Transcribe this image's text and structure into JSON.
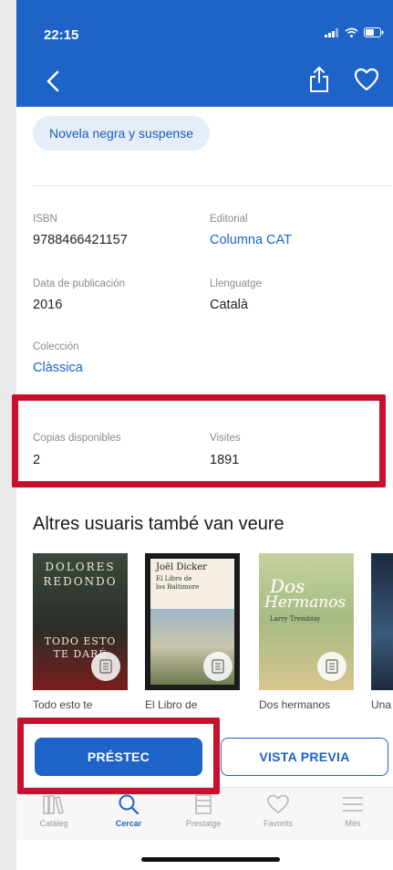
{
  "status_bar": {
    "time": "22:15"
  },
  "header": {
    "back_icon": "chevron-left-icon",
    "share_icon": "share-icon",
    "favorite_icon": "heart-icon",
    "color": "#1d63c8"
  },
  "genre_chip": "Novela negra y suspense",
  "details": {
    "isbn": {
      "label": "ISBN",
      "value": "9788466421157"
    },
    "publisher": {
      "label": "Editorial",
      "value": "Columna CAT"
    },
    "publication_date": {
      "label": "Data de publicación",
      "value": "2016"
    },
    "language": {
      "label": "Llenguatge",
      "value": "Català"
    },
    "collection": {
      "label": "Colección",
      "value": "Clàssica"
    },
    "copies": {
      "label": "Copias disponibles",
      "value": "2"
    },
    "visits": {
      "label": "Visites",
      "value": "1891"
    }
  },
  "related": {
    "title": "Altres usuaris també van veure",
    "books": [
      {
        "caption": "Todo esto te",
        "cover_lines": [
          "DOLORES",
          "REDONDO",
          "TODO ESTO",
          "TE DARÉ"
        ]
      },
      {
        "caption": "El Libro de",
        "cover_lines": [
          "Joël Dicker",
          "El Libro de",
          "los Baltimore"
        ]
      },
      {
        "caption": "Dos hermanos",
        "cover_lines": [
          "Dos",
          "Hermanos",
          "Larry Tremblay"
        ]
      },
      {
        "caption": "Una",
        "cover_lines": []
      }
    ]
  },
  "actions": {
    "loan_label": "PRÉSTEC",
    "preview_label": "VISTA PREVIA"
  },
  "tabs": [
    {
      "label": "Catàleg",
      "icon": "books-icon",
      "active": false
    },
    {
      "label": "Cercar",
      "icon": "search-icon",
      "active": true
    },
    {
      "label": "Prestatge",
      "icon": "shelf-icon",
      "active": false
    },
    {
      "label": "Favorits",
      "icon": "heart-icon",
      "active": false
    },
    {
      "label": "Més",
      "icon": "menu-icon",
      "active": false
    }
  ],
  "colors": {
    "accent": "#1d63c8",
    "highlight": "#c7102e"
  }
}
